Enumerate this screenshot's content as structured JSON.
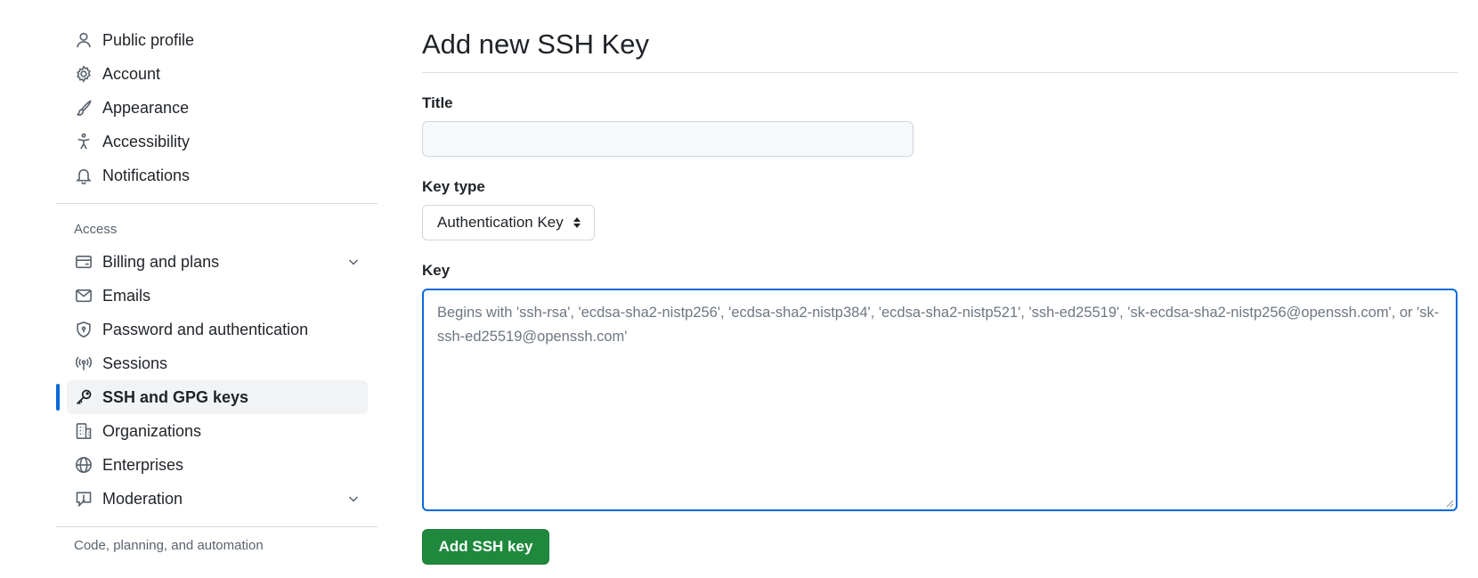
{
  "sidebar": {
    "top_items": [
      {
        "label": "Public profile"
      },
      {
        "label": "Account"
      },
      {
        "label": "Appearance"
      },
      {
        "label": "Accessibility"
      },
      {
        "label": "Notifications"
      }
    ],
    "access_heading": "Access",
    "access_items": [
      {
        "label": "Billing and plans"
      },
      {
        "label": "Emails"
      },
      {
        "label": "Password and authentication"
      },
      {
        "label": "Sessions"
      },
      {
        "label": "SSH and GPG keys"
      },
      {
        "label": "Organizations"
      },
      {
        "label": "Enterprises"
      },
      {
        "label": "Moderation"
      }
    ],
    "next_heading": "Code, planning, and automation"
  },
  "main": {
    "title": "Add new SSH Key",
    "title_field": {
      "label": "Title",
      "value": "",
      "placeholder": ""
    },
    "key_type": {
      "label": "Key type",
      "selected": "Authentication Key"
    },
    "key_field": {
      "label": "Key",
      "value": "",
      "placeholder": "Begins with 'ssh-rsa', 'ecdsa-sha2-nistp256', 'ecdsa-sha2-nistp384', 'ecdsa-sha2-nistp521', 'ssh-ed25519', 'sk-ecdsa-sha2-nistp256@openssh.com', or 'sk-ssh-ed25519@openssh.com'"
    },
    "submit_label": "Add SSH key"
  },
  "colors": {
    "accent": "#0969da",
    "primary_button": "#1f883d",
    "active_item_bg": "#f1f3f5",
    "muted_text": "#59636e"
  }
}
